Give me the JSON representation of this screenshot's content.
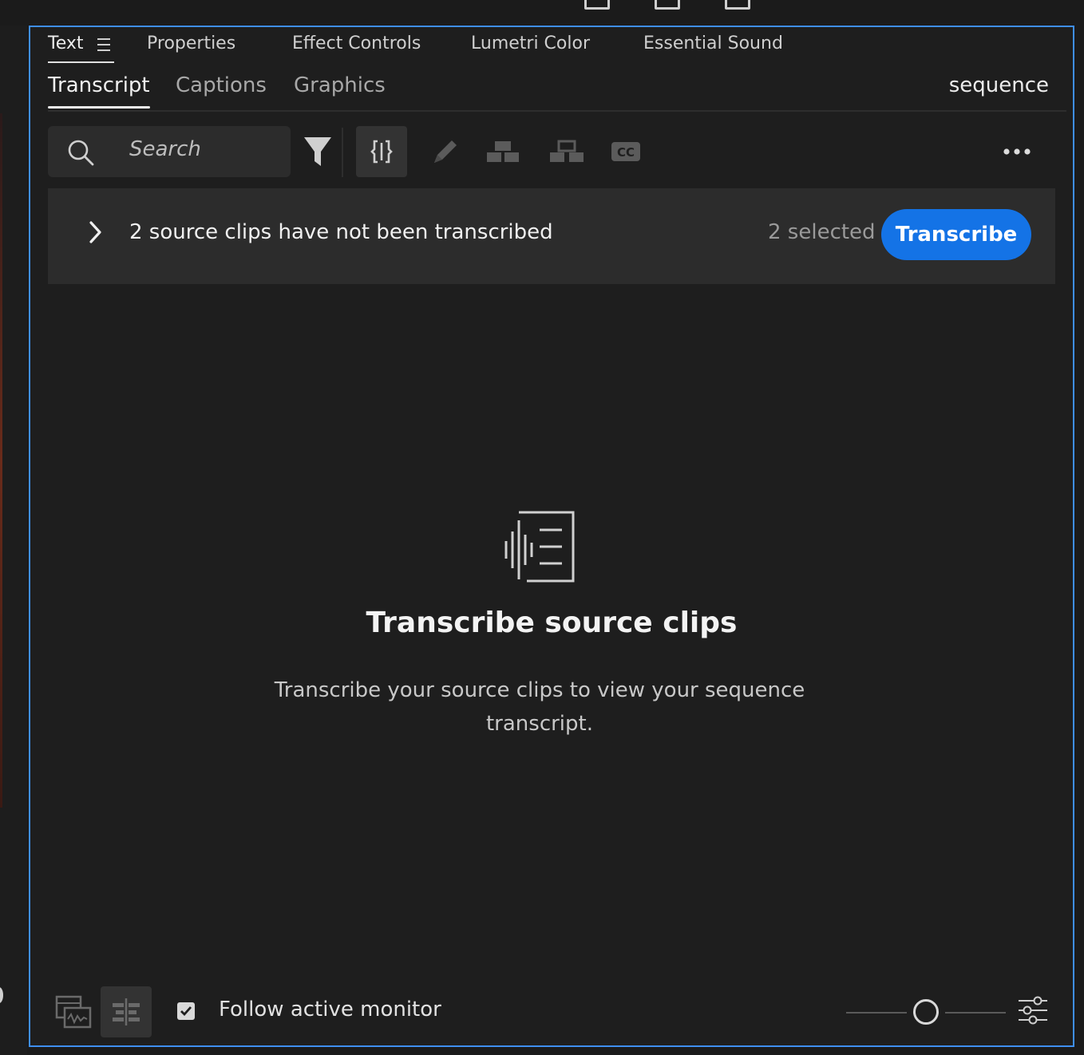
{
  "panel_tabs": [
    {
      "label": "Text",
      "active": true
    },
    {
      "label": "Properties"
    },
    {
      "label": "Effect Controls"
    },
    {
      "label": "Lumetri Color"
    },
    {
      "label": "Essential Sound"
    }
  ],
  "sub_tabs": [
    {
      "label": "Transcript",
      "active": true
    },
    {
      "label": "Captions"
    },
    {
      "label": "Graphics"
    }
  ],
  "sequence_label": "sequence",
  "search": {
    "placeholder": "Search"
  },
  "toolbar_icons": [
    "filter-icon",
    "split-segment-icon",
    "edit-pencil-icon",
    "merge-segments-icon",
    "add-segment-icon",
    "closed-captions-icon",
    "more-options-icon"
  ],
  "banner": {
    "message": "2 source clips have not been transcribed",
    "selected": "2 selected",
    "button_label": "Transcribe"
  },
  "empty_state": {
    "title": "Transcribe source clips",
    "description": "Transcribe your source clips to view your sequence transcript."
  },
  "footer": {
    "follow_label": "Follow active monitor",
    "follow_checked": true,
    "zoom_level": 0.5
  },
  "colors": {
    "accent": "#1473e6",
    "focus_border": "#3f8ff0",
    "panel_bg": "#1e1e1e"
  }
}
